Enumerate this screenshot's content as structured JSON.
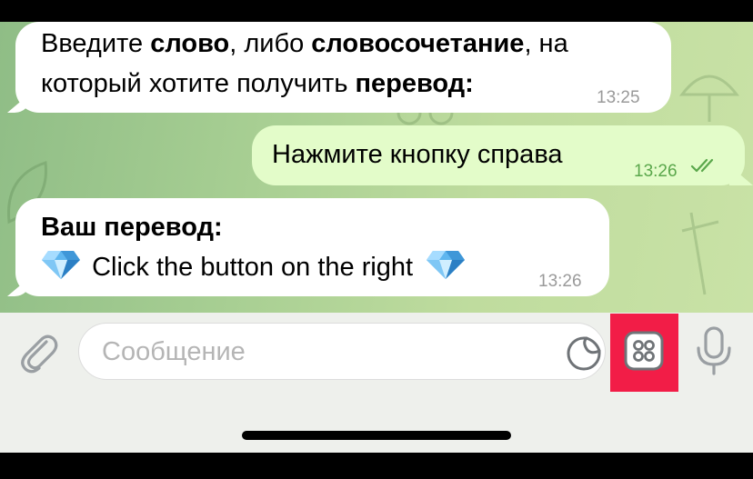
{
  "messages": [
    {
      "direction": "incoming",
      "line1_parts": [
        "Введите ",
        "слово",
        ", либо ",
        "словосочетание",
        ", на"
      ],
      "line2_parts": [
        "который хотите получить ",
        "перевод:"
      ],
      "time": "13:25"
    },
    {
      "direction": "outgoing",
      "text": "Нажмите кнопку справа",
      "time": "13:26",
      "status": "read"
    },
    {
      "direction": "incoming",
      "title": "Ваш перевод:",
      "text": "Click the button on the right",
      "time": "13:26"
    }
  ],
  "input": {
    "placeholder": "Сообщение"
  },
  "icons": {
    "attach": "paperclip-icon",
    "sticker": "sticker-icon",
    "bot_keyboard": "bot-keyboard-icon",
    "microphone": "microphone-icon",
    "gem": "gem-emoji-icon",
    "read_checks": "double-check-icon"
  },
  "colors": {
    "outgoing_bubble": "#e3fcc9",
    "outgoing_time": "#5aa74b",
    "highlight": "#f21d47",
    "icon_gray": "#9a9fa3"
  }
}
